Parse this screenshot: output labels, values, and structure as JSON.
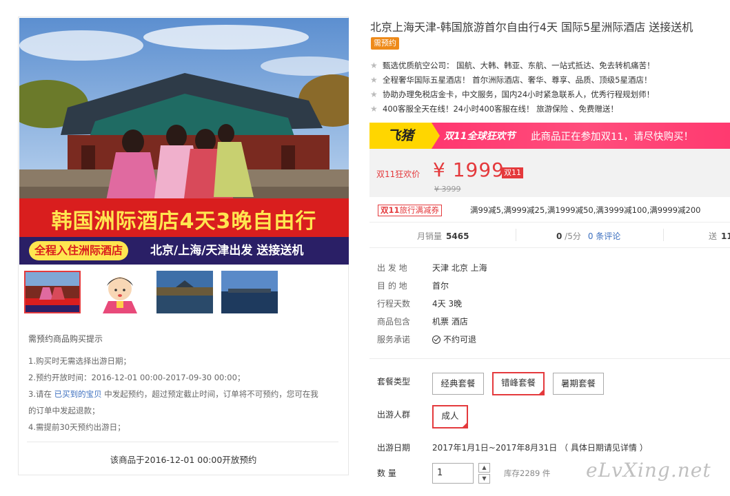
{
  "product": {
    "title": "北京上海天津-韩国旅游首尔自由行4天 国际5星洲际酒店 送接送机",
    "presale_badge": "需预约",
    "features": [
      "甄选优质航空公司：  国航、大韩、韩亚、东航、一站式抵达、免去转机痛苦！",
      "全程奢华国际五星酒店！  首尔洲际酒店、奢华、尊享、品质、顶级5星酒店！",
      "协助办理免税店金卡，中文服务，国内24小时紧急联系人，优秀行程规划师！",
      "400客服全天在线！24小时400客服在线！  旅游保险  、免费赠送！"
    ]
  },
  "main_image": {
    "headline": "韩国洲际酒店4天3晚自由行",
    "pill_text": "全程入住洲际酒店",
    "subline": "北京/上海/天津出发  送接送机"
  },
  "purchase_tips": {
    "title": "需预约商品购买提示",
    "line1": "1.购买时无需选择出游日期；",
    "line2": "2.预约开放时间：2016-12-01 00:00-2017-09-30 00:00；",
    "line3_a": "3.请在 ",
    "line3_link": "已买到的宝贝",
    "line3_b": " 中发起预约，超过预定截止时间，订单将不可预约，您可在我",
    "line3_c": "的订单中发起退款；",
    "line4": "4.需提前30天预约出游日；",
    "open_notice": "该商品于2016-12-01 00:00开放预约"
  },
  "promo": {
    "brand": "飞猪",
    "event_logo": "双11全球狂欢节",
    "message": "此商品正在参加双11，请尽快购买！",
    "brand_color": "#ffd600",
    "banner_color": "#ff3a70"
  },
  "price": {
    "label": "双11狂欢价",
    "value": "¥ 1999",
    "tag": "双11",
    "original": "¥ 3999",
    "color": "#e4393c"
  },
  "coupon": {
    "brand": "双11",
    "label": "旅行满减券",
    "detail": "满99减5,满999减25,满1999减50,满3999减100,满9999减200"
  },
  "stats": {
    "monthly_sales_label": "月销量",
    "monthly_sales_value": "5465",
    "rating_value": "0",
    "rating_suffix": " /5分",
    "reviews_link": "0 条评论",
    "points_label": "送",
    "points_value": "11"
  },
  "attributes": [
    {
      "label": "出 发 地",
      "value": "天津   北京   上海"
    },
    {
      "label": "目 的 地",
      "value": "首尔"
    },
    {
      "label": "行程天数",
      "value": "4天 3晚"
    },
    {
      "label": "商品包含",
      "value": "机票   酒店"
    },
    {
      "label": "服务承诺",
      "value": "不约可退"
    }
  ],
  "options": {
    "package_label": "套餐类型",
    "packages": [
      "经典套餐",
      "错峰套餐",
      "暑期套餐"
    ],
    "traveler_label": "出游人群",
    "travelers": [
      "成人"
    ],
    "date_label": "出游日期",
    "date_value": "2017年1月1日~2017年8月31日  （ 具体日期请见详情 ）",
    "quantity_label": "数      量",
    "quantity_value": "1",
    "stock": "库存2289 件"
  },
  "watermark": "eLvXing.net"
}
